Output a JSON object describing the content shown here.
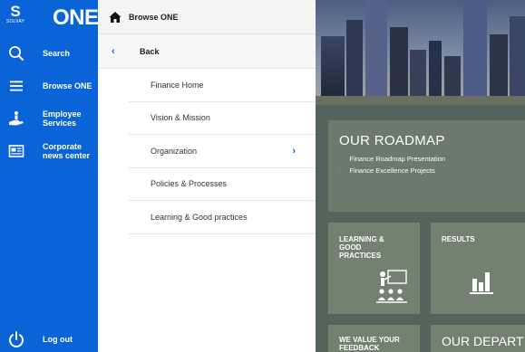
{
  "brand": {
    "company_letter": "S",
    "company_name": "SOLVAY",
    "app_name": "ONE"
  },
  "sidebar": {
    "items": [
      {
        "label": "Search",
        "icon": "search-icon"
      },
      {
        "label": "Browse ONE",
        "icon": "hamburger-menu-icon"
      },
      {
        "label": "Employee Services",
        "icon": "hand-person-icon"
      },
      {
        "label": "Corporate news center",
        "icon": "newspaper-icon"
      }
    ],
    "logout": {
      "label": "Log out",
      "icon": "power-icon"
    }
  },
  "panel": {
    "title": "Browse ONE",
    "back_label": "Back",
    "items": [
      {
        "label": "Finance Home",
        "has_children": false
      },
      {
        "label": "Vision & Mission",
        "has_children": false
      },
      {
        "label": "Organization",
        "has_children": true
      },
      {
        "label": "Policies & Processes",
        "has_children": false
      },
      {
        "label": "Learning & Good practices",
        "has_children": false
      }
    ]
  },
  "content": {
    "roadmap": {
      "title": "OUR ROADMAP",
      "links": [
        "Finance Roadmap Presentation",
        "Finance Excellence Projects"
      ]
    },
    "tiles": {
      "learning": "LEARNING & GOOD PRACTICES",
      "results": "RESULTS",
      "feedback": "WE VALUE YOUR FEEDBACK",
      "departments": "OUR DEPART"
    }
  },
  "colors": {
    "nav_blue": "#0a64d8",
    "accent_blue": "#0a64d8",
    "tile_green": "#76846f"
  }
}
